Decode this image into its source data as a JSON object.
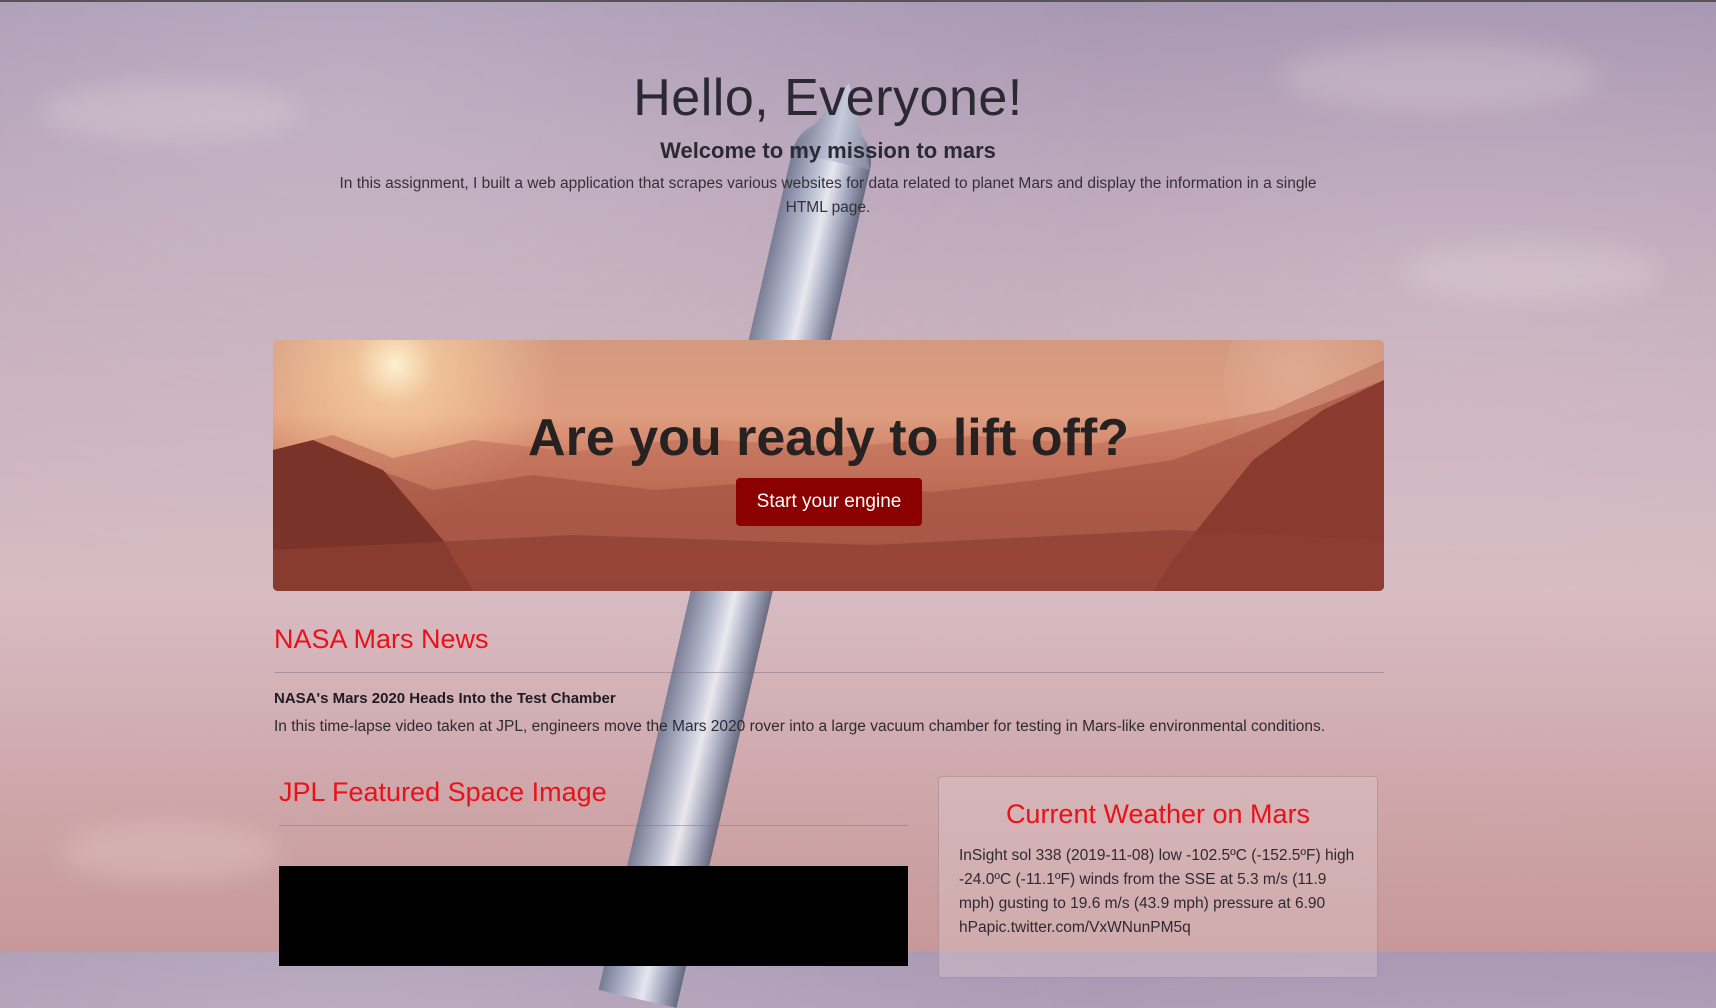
{
  "header": {
    "greeting": "Hello, Everyone!",
    "subtitle": "Welcome to my mission to mars",
    "description": "In this assignment, I built a web application that scrapes various websites for data related to planet Mars and display the information in a single HTML page."
  },
  "banner": {
    "heading": "Are you ready to lift off?",
    "button_label": "Start your engine"
  },
  "news": {
    "section_title": "NASA Mars News",
    "headline": "NASA's Mars 2020 Heads Into the Test Chamber",
    "paragraph": "In this time-lapse video taken at JPL, engineers move the Mars 2020 rover into a large vacuum chamber for testing in Mars-like environmental conditions."
  },
  "featured_image": {
    "section_title": "JPL Featured Space Image"
  },
  "weather": {
    "section_title": "Current Weather on Mars",
    "report": "InSight sol 338 (2019-11-08) low -102.5ºC (-152.5ºF) high -24.0ºC (-11.1ºF) winds from the SSE at 5.3 m/s (11.9 mph) gusting to 19.6 m/s (43.9 mph) pressure at 6.90 hPapic.twitter.com/VxWNunPM5q"
  },
  "colors": {
    "accent_red": "#e8121a",
    "button_bg": "#8b0000"
  }
}
